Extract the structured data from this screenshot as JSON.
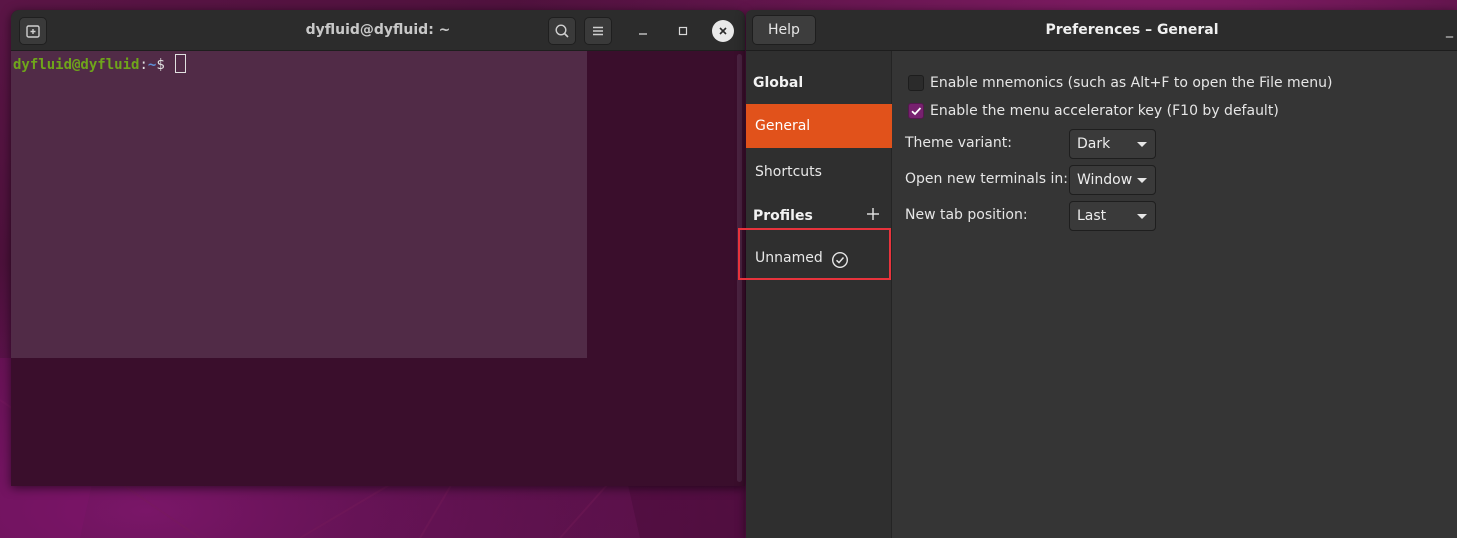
{
  "terminal": {
    "title": "dyfluid@dyfluid: ~",
    "prompt_user": "dyfluid@dyfluid",
    "prompt_colon": ":",
    "prompt_path": "~",
    "prompt_dollar": "$ "
  },
  "preferences": {
    "title": "Preferences – General",
    "help_label": "Help",
    "minimize_label": "_",
    "sidebar": {
      "global_heading": "Global",
      "items": [
        {
          "label": "General",
          "active": true
        },
        {
          "label": "Shortcuts",
          "active": false
        }
      ],
      "profiles_heading": "Profiles",
      "profiles": [
        {
          "label": "Unnamed",
          "default": true
        }
      ]
    },
    "general": {
      "checkboxes": [
        {
          "label": "Enable mnemonics (such as Alt+F to open the File menu)",
          "checked": false
        },
        {
          "label": "Enable the menu accelerator key (F10 by default)",
          "checked": true
        }
      ],
      "settings": [
        {
          "label": "Theme variant:",
          "value": "Dark"
        },
        {
          "label": "Open new terminals in:",
          "value": "Window"
        },
        {
          "label": "New tab position:",
          "value": "Last"
        }
      ]
    }
  },
  "colors": {
    "accent_orange": "#e1521b",
    "checkbox_purple": "#77216f",
    "highlight_red": "#e8333c",
    "prompt_green": "#6fa51b",
    "prompt_blue": "#5f8fd7"
  }
}
